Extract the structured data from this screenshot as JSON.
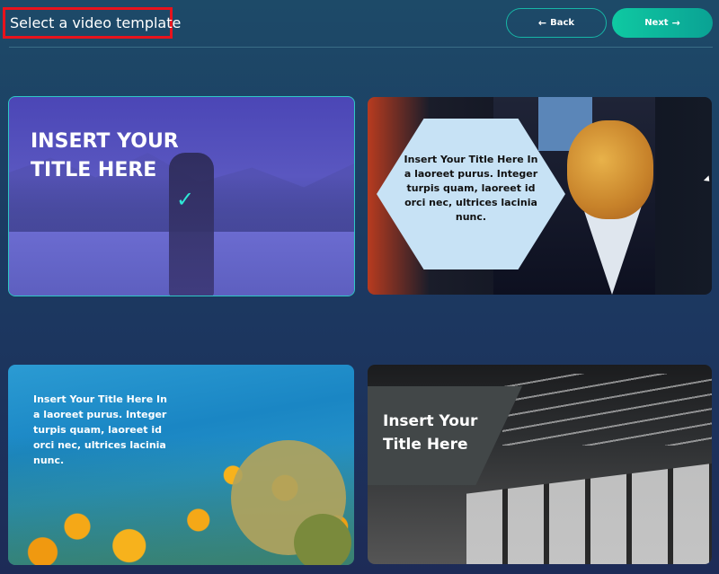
{
  "header": {
    "title": "Select a video template",
    "back_label": "Back",
    "next_label": "Next",
    "back_arrow": "←",
    "next_arrow": "→"
  },
  "templates": [
    {
      "title": "INSERT YOUR TITLE HERE",
      "selected": true,
      "check_icon": "✓"
    },
    {
      "title": "Insert Your Title Here In a laoreet purus. Integer turpis quam, laoreet id orci nec, ultrices lacinia nunc."
    },
    {
      "title": "Insert Your Title Here In a laoreet purus. Integer turpis quam, laoreet id orci nec, ultrices lacinia nunc."
    },
    {
      "title": "Insert Your Title Here"
    }
  ],
  "colors": {
    "accent": "#0fc9a2",
    "highlight_border": "#e8131c",
    "selected_border": "#2fc8c6"
  }
}
